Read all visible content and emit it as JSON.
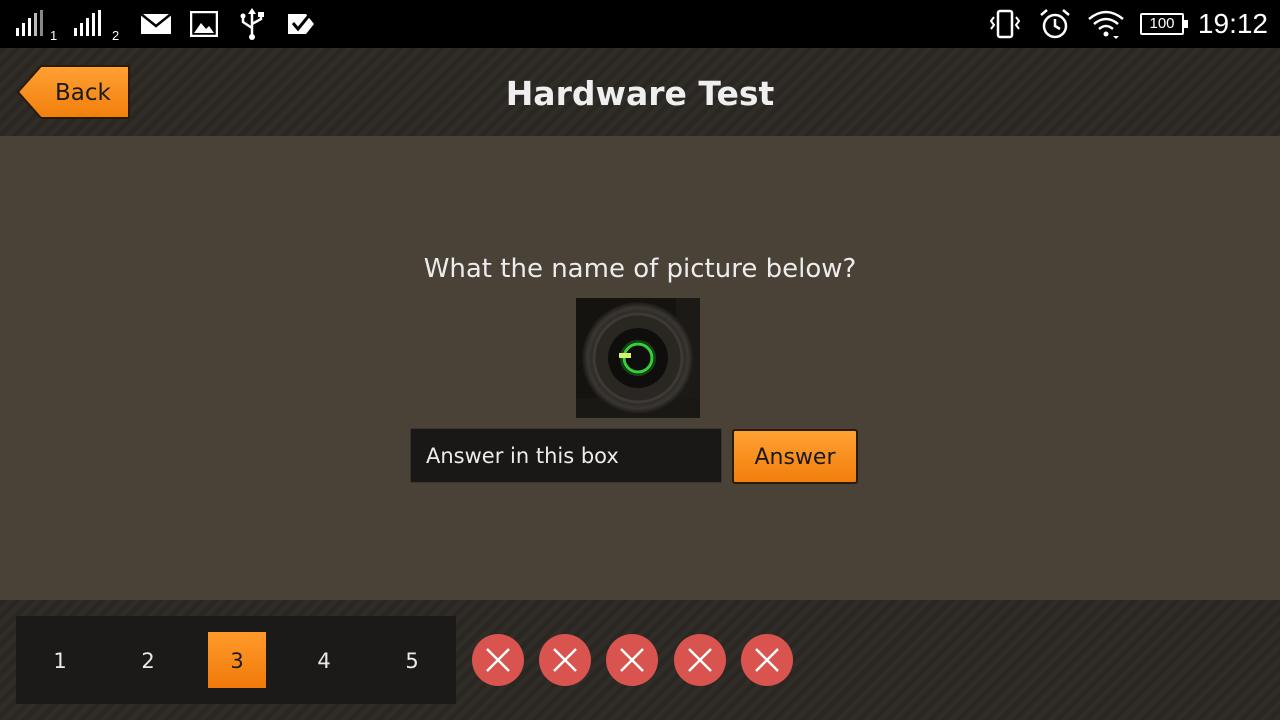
{
  "status_bar": {
    "sim1_label": "1",
    "sim2_label": "2",
    "battery": "100",
    "time": "19:12",
    "icons": [
      "signal-icon",
      "signal-icon",
      "mail-icon",
      "gallery-icon",
      "usb-icon",
      "checklist-icon",
      "vibrate-icon",
      "alarm-icon",
      "wifi-icon",
      "battery-icon"
    ]
  },
  "header": {
    "back_label": "Back",
    "title": "Hardware Test"
  },
  "main": {
    "question": "What the name of picture below?",
    "picture_icon": "power-button-icon",
    "answer_placeholder": "Answer in this box",
    "answer_value": "",
    "answer_button": "Answer"
  },
  "footer": {
    "pages": [
      "1",
      "2",
      "3",
      "4",
      "5"
    ],
    "active_page": "3",
    "results": [
      "wrong",
      "wrong",
      "wrong",
      "wrong",
      "wrong"
    ]
  },
  "colors": {
    "accent": "#f7891a",
    "background": "#4a4137",
    "wrong": "#d9534f"
  }
}
